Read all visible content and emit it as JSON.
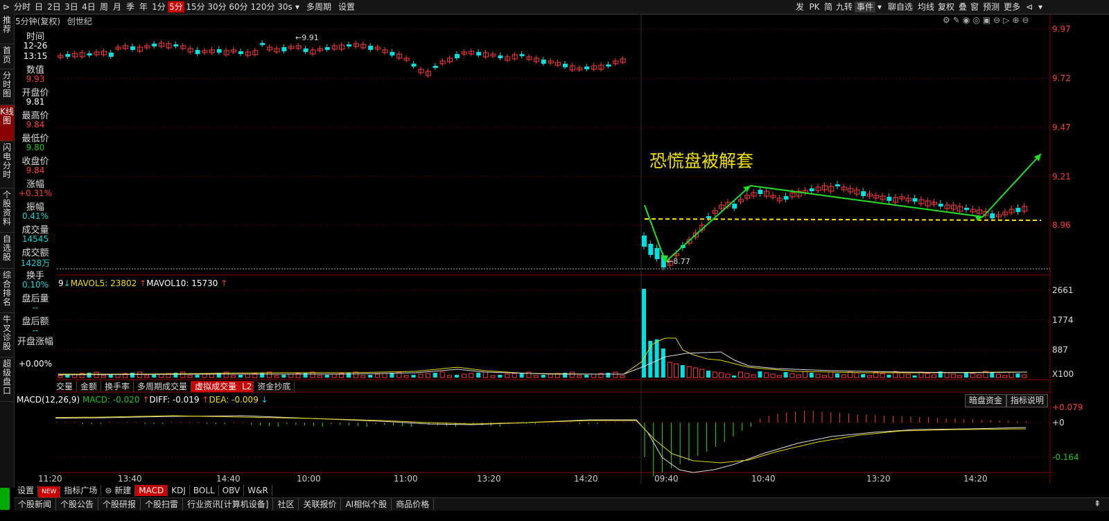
{
  "toolbar": {
    "left": [
      "分时",
      "日",
      "2日",
      "3日",
      "4日",
      "周",
      "月",
      "季",
      "年",
      "1分",
      "5分",
      "15分",
      "30分",
      "60分",
      "120分",
      "30s",
      "多周期",
      "设置"
    ],
    "active": "5分",
    "right": [
      "发",
      "PK",
      "简",
      "九转",
      "事件",
      "聊自选",
      "均线",
      "复权",
      "叠",
      "窗",
      "预测",
      "更多"
    ]
  },
  "leftnav": [
    "推荐",
    "首页",
    "分时图",
    "K线图",
    "闪电分时",
    "个股资料",
    "自选股",
    "综合排名",
    "牛叉诊股",
    "超级盘口"
  ],
  "leftnav_active": "K线图",
  "title": {
    "period": "5分钟(复权)",
    "name": "创世纪"
  },
  "info": [
    {
      "label": "时间",
      "val": "12-26",
      "val2": "13:15",
      "color": "white"
    },
    {
      "label": "数值",
      "val": "9.93",
      "color": "red"
    },
    {
      "label": "开盘价",
      "val": "9.81",
      "color": "white"
    },
    {
      "label": "最高价",
      "val": "9.84",
      "color": "red"
    },
    {
      "label": "最低价",
      "val": "9.80",
      "color": "green"
    },
    {
      "label": "收盘价",
      "val": "9.84",
      "color": "red"
    },
    {
      "label": "涨幅",
      "val": "+0.31%",
      "color": "red"
    },
    {
      "label": "振幅",
      "val": "0.41%",
      "color": "cyan"
    },
    {
      "label": "成交量",
      "val": "14545",
      "color": "cyan"
    },
    {
      "label": "成交额",
      "val": "1428万",
      "color": "cyan"
    },
    {
      "label": "换手",
      "val": "0.10%",
      "color": "cyan"
    },
    {
      "label": "盘后量",
      "val": "--",
      "color": "cyan"
    },
    {
      "label": "盘后额",
      "val": "--",
      "color": "cyan"
    },
    {
      "label": "开盘涨幅",
      "val": "+0.00%",
      "color": "white"
    }
  ],
  "price_axis": [
    "9.97",
    "9.72",
    "9.47",
    "9.21",
    "8.96"
  ],
  "annotations": {
    "high": "9.91",
    "low": "8.77",
    "caption": "恐慌盘被解套"
  },
  "volume": {
    "legend_prefix": "9",
    "mavol5_label": "MAVOL5: 23802",
    "mavol10_label": "MAVOL10: 15730",
    "axis": [
      "2661",
      "1774",
      "887",
      "X100"
    ],
    "tabs": [
      "交量",
      "金额",
      "换手率",
      "多周期成交量",
      "虚拟成交量",
      "资金抄底"
    ],
    "active_tab": "虚拟成交量",
    "l2": "L2"
  },
  "macd": {
    "name": "MACD(12,26,9)",
    "macd": "MACD: -0.020",
    "diff": "DIFF: -0.019",
    "dea": "DEA: -0.009",
    "axis": [
      "+0.079",
      "+0",
      "-0.164"
    ],
    "btn_dark": "暗盘资金",
    "btn_help": "指标说明"
  },
  "time_axis": [
    "11:20",
    "13:40",
    "14:40",
    "10:00",
    "11:00",
    "13:20",
    "14:20",
    "09:40",
    "10:40",
    "13:20",
    "14:20"
  ],
  "bottom_tabs": [
    "设置",
    "NEW",
    "指标广场",
    "新建",
    "MACD",
    "KDJ",
    "BOLL",
    "OBV",
    "W&R"
  ],
  "bottom_active": "MACD",
  "news": [
    "个股新闻",
    "个股公告",
    "个股研报",
    "个股扫雷",
    "行业资讯[计算机设备]",
    "社区",
    "关联报价",
    "AI相似个股",
    "商品价格"
  ],
  "colors": {
    "up": "#ff3b3b",
    "down": "#00e0e0",
    "accent_green": "#22e022",
    "accent_yellow": "#f0e000"
  }
}
